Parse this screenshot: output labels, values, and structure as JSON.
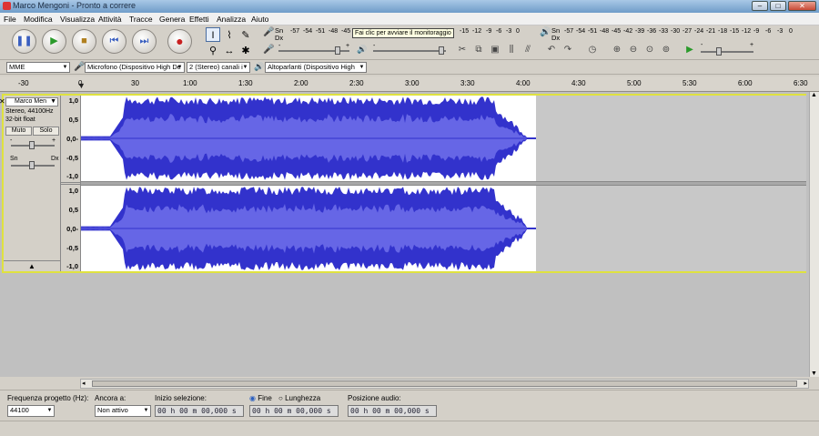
{
  "window": {
    "title": "Marco Mengoni - Pronto a correre"
  },
  "menu": [
    "File",
    "Modifica",
    "Visualizza",
    "Attività",
    "Tracce",
    "Genera",
    "Effetti",
    "Analizza",
    "Aiuto"
  ],
  "meters": {
    "rec_lr": "Sn\nDx",
    "rec_ticks": [
      "-57",
      "-54",
      "-51",
      "-48",
      "-45"
    ],
    "rec_ticks_tail": [
      "-15",
      "-12",
      "-9",
      "-6",
      "-3",
      "0"
    ],
    "monitor_tip": "Fai clic per avviare il monitoraggio",
    "play_lr": "Sn\nDx",
    "play_ticks": [
      "-57",
      "-54",
      "-51",
      "-48",
      "-45",
      "-42",
      "-39",
      "-36",
      "-33",
      "-30",
      "-27",
      "-24",
      "-21",
      "-18",
      "-15",
      "-12",
      "-9",
      "-6",
      "-3",
      "0"
    ]
  },
  "devices": {
    "host": "MME",
    "mic": "Microfono (Dispositivo High De",
    "channels": "2 (Stereo) canali i",
    "speakers": "Altoparlanti (Dispositivo High"
  },
  "ruler": [
    "-30",
    "0",
    "30",
    "1:00",
    "1:30",
    "2:00",
    "2:30",
    "3:00",
    "3:30",
    "4:00",
    "4:30",
    "5:00",
    "5:30",
    "6:00",
    "6:30"
  ],
  "track": {
    "name": "Marco Men",
    "info1": "Stereo, 44100Hz",
    "info2": "32-bit float",
    "mute": "Muto",
    "solo": "Solo",
    "gain_minus": "-",
    "gain_plus": "+",
    "pan_left": "Sn",
    "pan_right": "Dx",
    "scale": [
      "1,0",
      "0,5",
      "0,0-",
      "-0,5",
      "-1,0"
    ]
  },
  "selection": {
    "rate_label": "Frequenza progetto (Hz):",
    "rate_value": "44100",
    "snap_label": "Ancora a:",
    "snap_value": "Non attivo",
    "start_label": "Inizio selezione:",
    "start_value": "00 h 00 m 00,000 s",
    "end_option": "Fine",
    "length_option": "Lunghezza",
    "end_value": "00 h 00 m 00,000 s",
    "pos_label": "Posizione audio:",
    "pos_value": "00 h 00 m 00,000 s"
  }
}
